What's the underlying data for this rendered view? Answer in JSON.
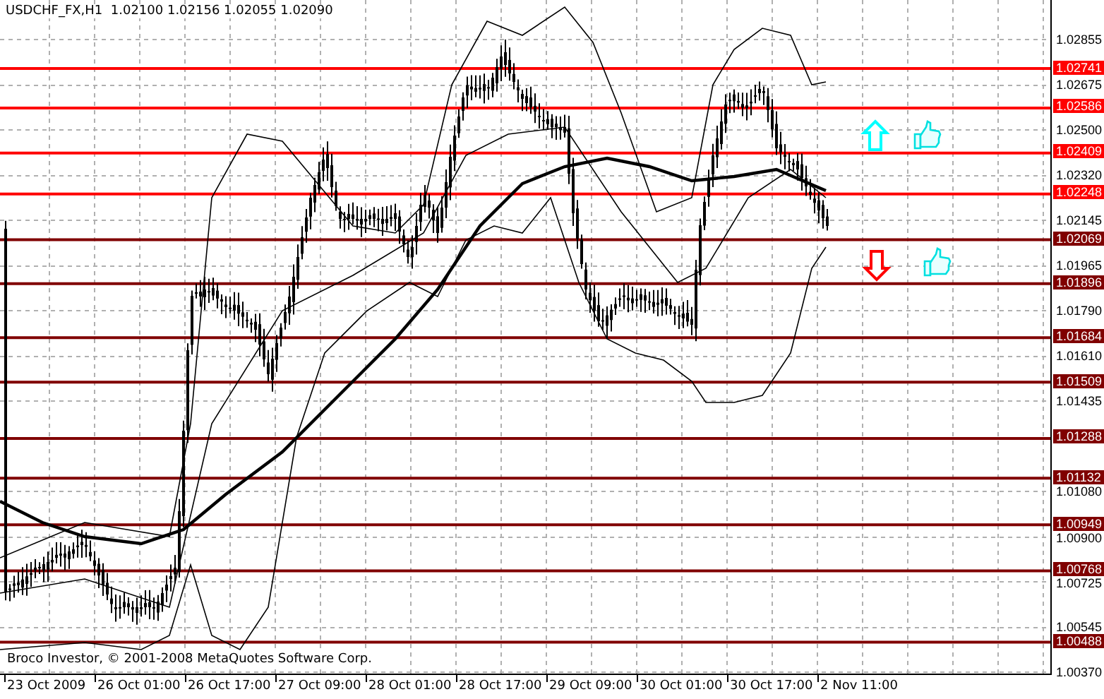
{
  "chart": {
    "symbol": "USDCHF_FX,H1",
    "ohlc": [
      "1.02100",
      "1.02156",
      "1.02055",
      "1.02090"
    ],
    "price_ticks": [
      "1.02855",
      "1.02675",
      "1.02500",
      "1.02320",
      "1.02145",
      "1.01965",
      "1.01790",
      "1.01610",
      "1.01435",
      "1.01080",
      "1.00900",
      "1.00725",
      "1.00545",
      "1.00370"
    ],
    "levels": [
      {
        "label": "1.02741",
        "color": "#ff0000"
      },
      {
        "label": "1.02586",
        "color": "#ff0000"
      },
      {
        "label": "1.02409",
        "color": "#ff0000"
      },
      {
        "label": "1.02248",
        "color": "#ff0000"
      },
      {
        "label": "1.02069",
        "color": "#800000"
      },
      {
        "label": "1.01896",
        "color": "#800000"
      },
      {
        "label": "1.01684",
        "color": "#800000"
      },
      {
        "label": "1.01509",
        "color": "#800000"
      },
      {
        "label": "1.01288",
        "color": "#800000"
      },
      {
        "label": "1.01132",
        "color": "#800000"
      },
      {
        "label": "1.00949",
        "color": "#800000"
      },
      {
        "label": "1.00768",
        "color": "#800000"
      },
      {
        "label": "1.00488",
        "color": "#800000"
      }
    ],
    "time_labels": [
      "23 Oct 2009",
      "26 Oct 01:00",
      "26 Oct 17:00",
      "27 Oct 09:00",
      "28 Oct 01:00",
      "28 Oct 17:00",
      "29 Oct 09:00",
      "30 Oct 01:00",
      "30 Oct 17:00",
      "2 Nov 11:00"
    ],
    "signals": [
      {
        "kind": "up",
        "color": "#00ffff"
      },
      {
        "kind": "down",
        "color": "#ff0000"
      }
    ],
    "copyright": "Broco Investor, © 2001-2008 MetaQuotes Software Corp."
  }
}
